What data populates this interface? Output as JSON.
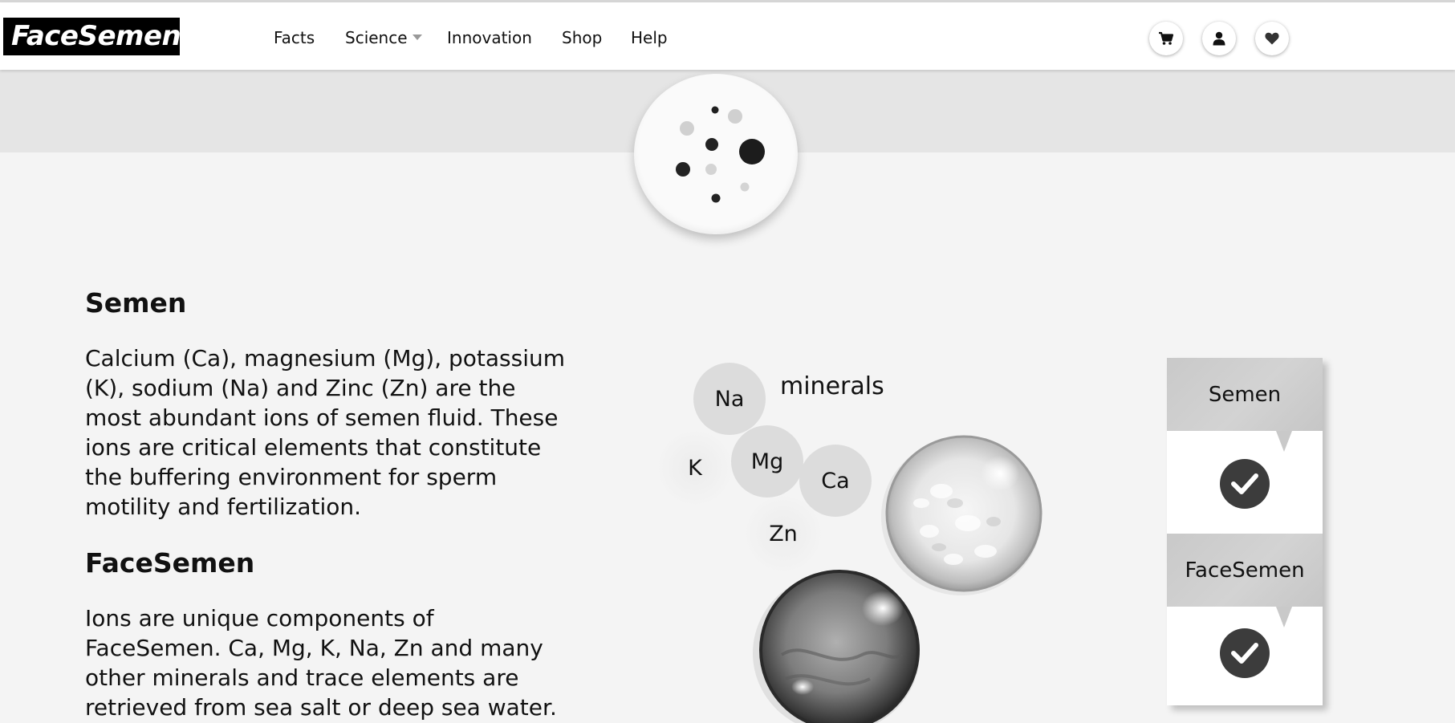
{
  "header": {
    "logo_text": "FaceSemen",
    "nav": [
      {
        "label": "Facts"
      },
      {
        "label": "Science",
        "has_dropdown": true
      },
      {
        "label": "Innovation"
      },
      {
        "label": "Shop"
      },
      {
        "label": "Help"
      }
    ],
    "icons": [
      "cart-icon",
      "user-icon",
      "heart-icon"
    ]
  },
  "content": {
    "semen_heading": "Semen",
    "semen_text": "Calcium (Ca), magnesium (Mg), potassium (K), sodium (Na) and Zinc (Zn) are the most abundant ions of semen fluid. These ions are critical elements that constitute the buffering environment for sperm motility and fertilization.",
    "facesemen_heading": "FaceSemen",
    "facesemen_text": "Ions are unique components of FaceSemen. Ca, Mg, K, Na, Zn and many other minerals and trace elements are retrieved from sea salt or deep sea water."
  },
  "illustration": {
    "ions": [
      "Na",
      "K",
      "Mg",
      "Ca",
      "Zn"
    ],
    "minerals_label": "minerals"
  },
  "comparison": {
    "rows": [
      {
        "label": "Semen",
        "checked": true
      },
      {
        "label": "FaceSemen",
        "checked": true
      }
    ]
  },
  "colors": {
    "header_bg": "#ffffff",
    "logo_bg": "#000000",
    "page_bg": "#f4f4f4",
    "band_bg": "#e5e5e5",
    "check_bg": "#3c3c3c"
  }
}
